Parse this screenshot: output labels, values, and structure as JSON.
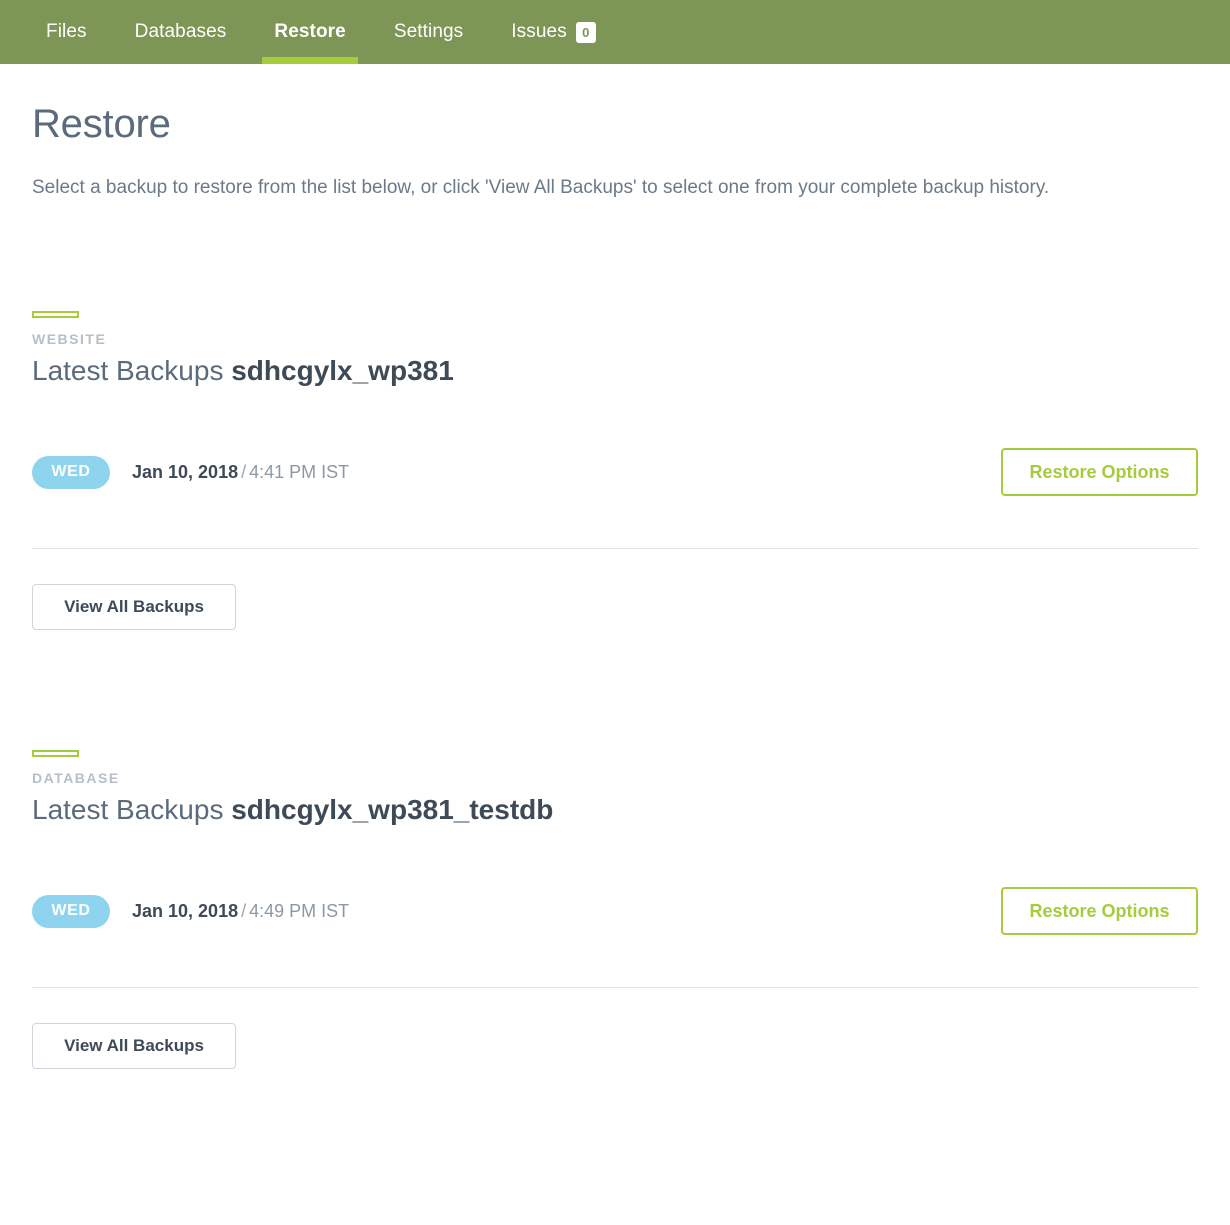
{
  "nav": {
    "tabs": [
      {
        "label": "Files",
        "active": false
      },
      {
        "label": "Databases",
        "active": false
      },
      {
        "label": "Restore",
        "active": true
      },
      {
        "label": "Settings",
        "active": false
      },
      {
        "label": "Issues",
        "active": false,
        "badge": "0"
      }
    ]
  },
  "header": {
    "title": "Restore",
    "description": "Select a backup to restore from the list below, or click 'View All Backups' to select one from your complete backup history."
  },
  "sections": [
    {
      "kicker": "WEBSITE",
      "heading_prefix": "Latest Backups",
      "target_name": "sdhcgylx_wp381",
      "backup": {
        "day": "WED",
        "date": "Jan 10, 2018",
        "separator": "/",
        "time": "4:41 PM IST",
        "restore_label": "Restore Options"
      },
      "view_all_label": "View All Backups"
    },
    {
      "kicker": "DATABASE",
      "heading_prefix": "Latest Backups",
      "target_name": "sdhcgylx_wp381_testdb",
      "backup": {
        "day": "WED",
        "date": "Jan 10, 2018",
        "separator": "/",
        "time": "4:49 PM IST",
        "restore_label": "Restore Options"
      },
      "view_all_label": "View All Backups"
    }
  ],
  "colors": {
    "nav_background": "#7d9555",
    "accent_green": "#a6cb3c",
    "day_pill_blue": "#8ed4ee",
    "heading_gray": "#5b6b7c",
    "divider": "#dfe3e8"
  }
}
